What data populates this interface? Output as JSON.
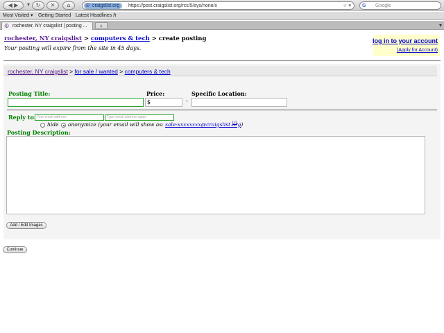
{
  "browser": {
    "nav": {
      "back": "◀",
      "forward": "▶",
      "history_dropdown": "▾",
      "reload": "↻",
      "stop": "✕",
      "home": "⌂"
    },
    "site_badge": "craigslist.org",
    "url": "https://post.craigslist.org/rcs/5/sys/none/x",
    "url_icons": "☆ ▾",
    "search_engine_icon": "G",
    "search_placeholder": "Google",
    "bookmarks": [
      "Most Visited ▾",
      "Getting Started",
      "Latest Headlines ℏ"
    ],
    "tab_title": "rochester, NY craigslist | posting ...",
    "new_tab": "+",
    "tab_list": "▾"
  },
  "header": {
    "site": "rochester, NY craigslist",
    "sep1": ">",
    "category": "computers & tech",
    "sep2": ">",
    "page": "create posting",
    "expiry_note": "Your posting will expire from the site in 45 days."
  },
  "account": {
    "login": "log in to your account",
    "apply": "(Apply for Account)"
  },
  "form": {
    "breadcrumb": {
      "site": "rochester, NY craigslist",
      "sep1": ">",
      "section": "for sale / wanted",
      "sep2": ">",
      "category": "computers & tech"
    },
    "posting_title_label": "Posting Title:",
    "price_label": "Price:",
    "currency": "$",
    "dash": "-",
    "location_label": "Specific Location:",
    "reply_to_label": "Reply to:",
    "email_placeholder": "Your email address",
    "email_again_placeholder": "Type email address again",
    "hide_label": "hide",
    "anonymize_text": "anonymize (your email will show as:",
    "anonymize_email": "sale-xxxxxxxx@craigslist.org",
    "anonymize_close": ")",
    "help_link": "[?]",
    "selected_reply_option": "anonymize",
    "description_label": "Posting Description:",
    "add_images_button": "Add / Edit Images",
    "continue_button": "Continue"
  },
  "colors": {
    "link": "#0000cc",
    "visited": "#551a8b",
    "label_green": "#008000",
    "login_bg": "#ffffcc"
  }
}
